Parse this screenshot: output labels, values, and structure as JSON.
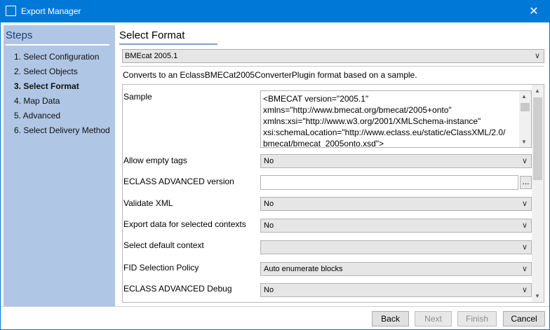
{
  "window": {
    "title": "Export Manager",
    "close_glyph": "✕"
  },
  "sidebar": {
    "heading": "Steps",
    "steps": [
      "1. Select Configuration",
      "2. Select Objects",
      "3. Select Format",
      "4. Map Data",
      "5. Advanced",
      "6. Select Delivery Method"
    ],
    "active_index": 2
  },
  "main": {
    "heading": "Select Format",
    "format_value": "BMEcat 2005.1",
    "description": "Converts to an EclassBMECat2005ConverterPlugin format based on a sample.",
    "properties": {
      "sample": {
        "label": "Sample",
        "lines": [
          "<BMECAT version=\"2005.1\"",
          "xmlns=\"http://www.bmecat.org/bmecat/2005+onto\"",
          "xmlns:xsi=\"http://www.w3.org/2001/XMLSchema-instance\"",
          "xsi:schemaLocation=\"http://www.eclass.eu/static/eClassXML/2.0/",
          "bmecat/bmecat_2005onto.xsd\">"
        ]
      },
      "allow_empty_tags": {
        "label": "Allow empty tags",
        "value": "No"
      },
      "eclass_version": {
        "label": "ECLASS ADVANCED version",
        "value": "",
        "button": "..."
      },
      "validate_xml": {
        "label": "Validate XML",
        "value": "No"
      },
      "export_contexts": {
        "label": "Export data for selected contexts",
        "value": "No"
      },
      "default_context": {
        "label": "Select default context",
        "value": ""
      },
      "fid_policy": {
        "label": "FID Selection Policy",
        "value": "Auto enumerate blocks"
      },
      "eclass_debug": {
        "label": "ECLASS ADVANCED Debug",
        "value": "No"
      }
    }
  },
  "footer": {
    "back": "Back",
    "next": "Next",
    "finish": "Finish",
    "cancel": "Cancel"
  },
  "colors": {
    "titlebar": "#0078d7",
    "sidebar": "#b0c6e5",
    "accent_rule": "#7aa3d6"
  },
  "icons": {
    "chevron": "chevron-down-icon",
    "close": "close-icon",
    "app": "app-icon"
  }
}
